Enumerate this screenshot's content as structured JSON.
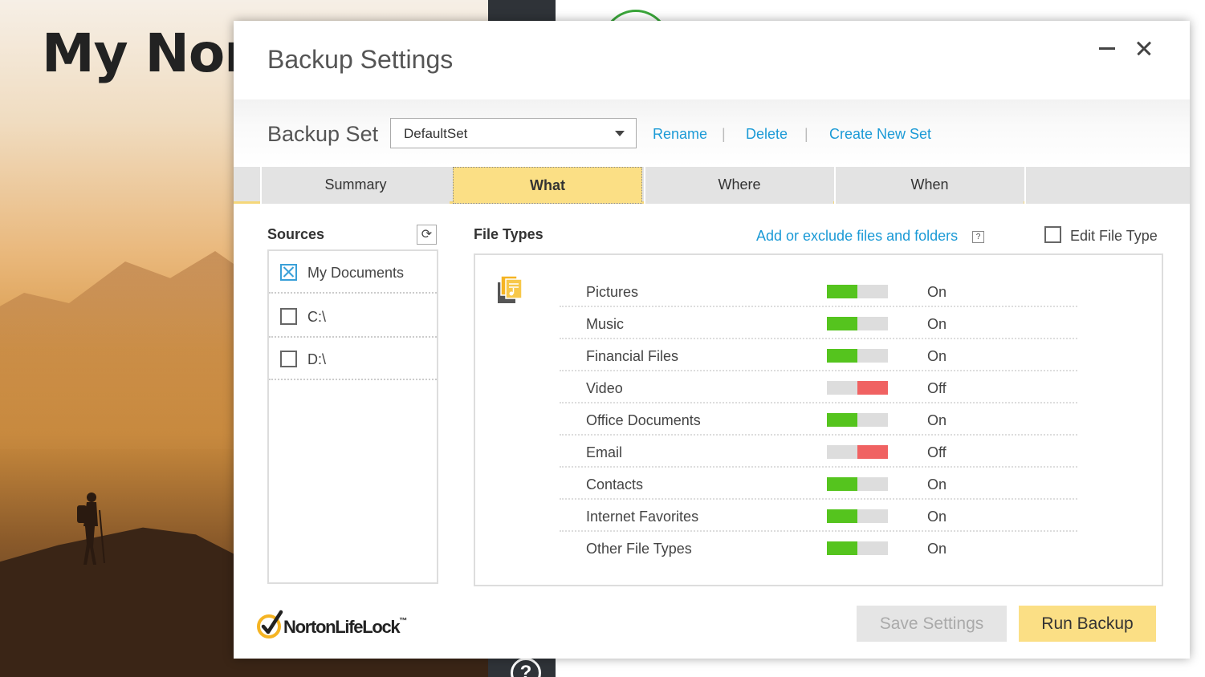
{
  "background": {
    "app_title": "My Nor"
  },
  "dialog": {
    "title": "Backup Settings",
    "backup_set": {
      "label": "Backup Set",
      "selected": "DefaultSet",
      "links": [
        "Rename",
        "Delete",
        "Create New Set"
      ],
      "separator": "|"
    },
    "tabs": [
      {
        "label": "Summary",
        "active": false
      },
      {
        "label": "What",
        "active": true
      },
      {
        "label": "Where",
        "active": false
      },
      {
        "label": "When",
        "active": false
      }
    ],
    "sources": {
      "heading": "Sources",
      "items": [
        {
          "label": "My Documents",
          "checked": true
        },
        {
          "label": "C:\\",
          "checked": false
        },
        {
          "label": "D:\\",
          "checked": false
        }
      ]
    },
    "file_types": {
      "heading": "File Types",
      "add_link": "Add or exclude files and folders",
      "help_label": "?",
      "edit_label": "Edit File Type",
      "edit_checked": false,
      "items": [
        {
          "name": "Pictures",
          "state": "On",
          "on": true
        },
        {
          "name": "Music",
          "state": "On",
          "on": true
        },
        {
          "name": "Financial Files",
          "state": "On",
          "on": true
        },
        {
          "name": "Video",
          "state": "Off",
          "on": false
        },
        {
          "name": "Office Documents",
          "state": "On",
          "on": true
        },
        {
          "name": "Email",
          "state": "Off",
          "on": false
        },
        {
          "name": "Contacts",
          "state": "On",
          "on": true
        },
        {
          "name": "Internet Favorites",
          "state": "On",
          "on": true
        },
        {
          "name": "Other File Types",
          "state": "On",
          "on": true
        }
      ]
    },
    "logo": {
      "text": "NortonLifeLock",
      "tm": "™"
    },
    "buttons": {
      "save": "Save Settings",
      "run": "Run Backup"
    }
  },
  "colors": {
    "accent_yellow": "#fbdf85",
    "link_blue": "#1b9ad6",
    "toggle_on": "#55c41e",
    "toggle_off": "#f06262"
  },
  "icons": {
    "minimize": "minimize-icon",
    "close": "close-icon",
    "dropdown": "chevron-down-icon",
    "refresh": "refresh-icon",
    "file_types": "file-types-icon",
    "help": "question-circle-icon",
    "logo": "norton-check-icon"
  }
}
